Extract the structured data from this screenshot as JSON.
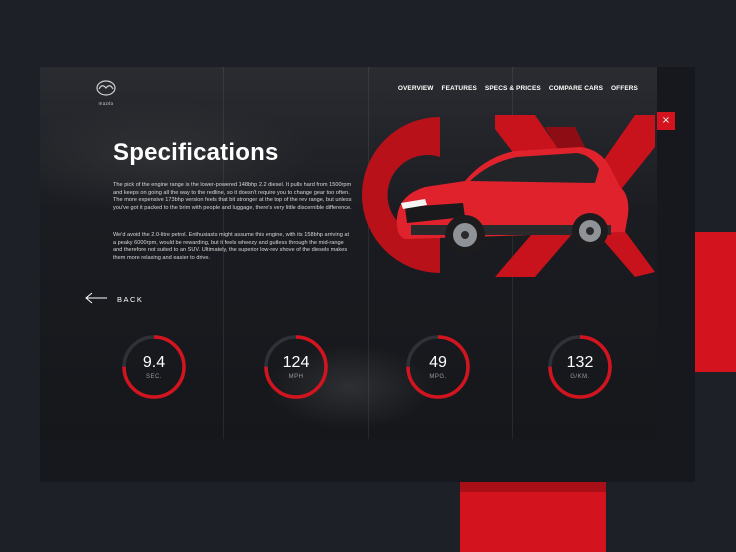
{
  "brand": {
    "logo_text": "mazda"
  },
  "nav": {
    "items": [
      {
        "label": "OVERVIEW"
      },
      {
        "label": "FEATURES"
      },
      {
        "label": "SPECS & PRICES"
      },
      {
        "label": "COMPARE CARS"
      },
      {
        "label": "OFFERS"
      }
    ]
  },
  "close_symbol": "×",
  "page": {
    "title": "Specifications",
    "paragraph_1": "The pick of the engine range is the lower-powered 148bhp 2.2 diesel. It pulls hard from 1500rpm and keeps on going all the way to the redline, so it doesn't require you to change gear too often. The more expensive 173bhp version feels that bit stronger at the top of the rev range, but unless you've got it packed to the brim with people and luggage, there's very little discernible difference.",
    "paragraph_2": "We'd avoid the 2.0-litre petrol. Enthusiasts might assume this engine, with its 158bhp arriving at a peaky 6000rpm, would be rewarding, but it feels wheezy and gutless through the mid-range and therefore not suited to an SUV. Ultimately, the superior low-rev shove of the diesels makes them more relaxing and easier to drive.",
    "back_label": "BACK"
  },
  "stats": [
    {
      "value": "9.4",
      "unit": "SEC.",
      "fill": 0.75
    },
    {
      "value": "124",
      "unit": "MPH",
      "fill": 0.75
    },
    {
      "value": "49",
      "unit": "MPG.",
      "fill": 0.75
    },
    {
      "value": "132",
      "unit": "G/KM.",
      "fill": 0.75
    }
  ],
  "colors": {
    "accent": "#d3141e",
    "background": "#1d2026",
    "card": "#16181d",
    "ring_track": "#2e3137"
  },
  "icons": [
    "mazda-logo-icon",
    "close-icon",
    "arrow-left-icon"
  ]
}
